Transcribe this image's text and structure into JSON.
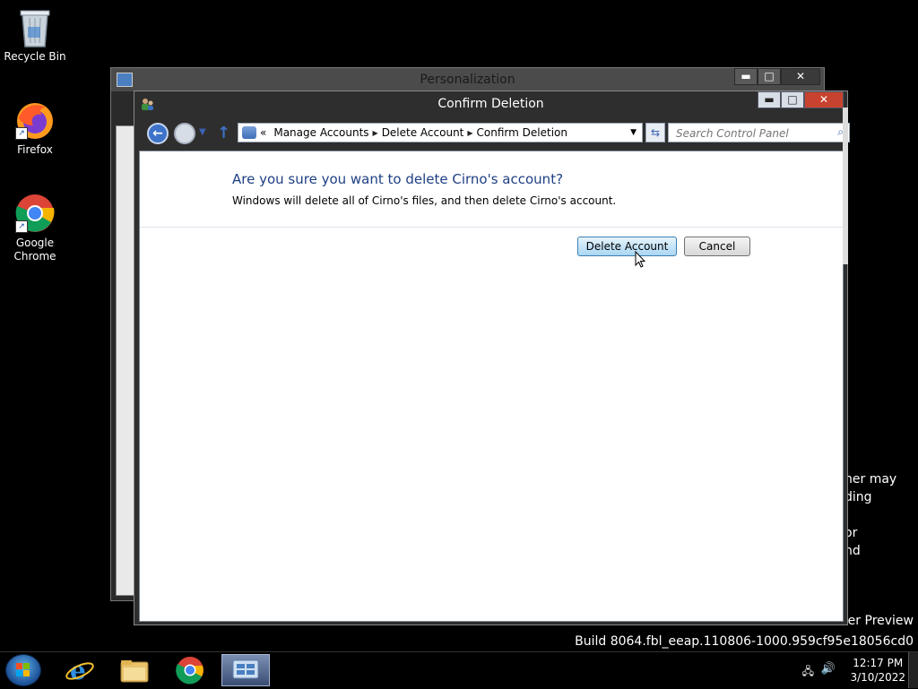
{
  "desktop": {
    "icons": [
      {
        "label": "Recycle Bin"
      },
      {
        "label": "Firefox"
      },
      {
        "label": "Google Chrome"
      }
    ],
    "watermark": {
      "line1": "ner may",
      "line2": "ding",
      "line3": "or",
      "line4": "nd",
      "preview": "er Preview",
      "build": "Build 8064.fbl_eeap.110806-1000.959cf95e18056cd0"
    }
  },
  "background_window": {
    "title": "Personalization",
    "buttons": {
      "minimize": "▬",
      "maximize": "□",
      "close": "✕"
    }
  },
  "window": {
    "title": "Confirm Deletion",
    "buttons": {
      "minimize": "▬",
      "maximize": "□",
      "close": "✕"
    },
    "breadcrumb": {
      "prefix": "«",
      "items": [
        "Manage Accounts",
        "Delete Account",
        "Confirm Deletion"
      ]
    },
    "search": {
      "placeholder": "Search Control Panel",
      "value": ""
    },
    "heading": "Are you sure you want to delete Cirno's account?",
    "description": "Windows will delete all of Cirno's files, and then delete Cirno's account.",
    "delete_button": "Delete Account",
    "cancel_button": "Cancel"
  },
  "taskbar": {
    "items": [
      "Internet Explorer",
      "File Explorer",
      "Google Chrome",
      "Control Panel"
    ],
    "clock": {
      "time": "12:17 PM",
      "date": "3/10/2022"
    }
  },
  "colors": {
    "heading": "#1e3f84",
    "accent": "#3c7fb1"
  }
}
